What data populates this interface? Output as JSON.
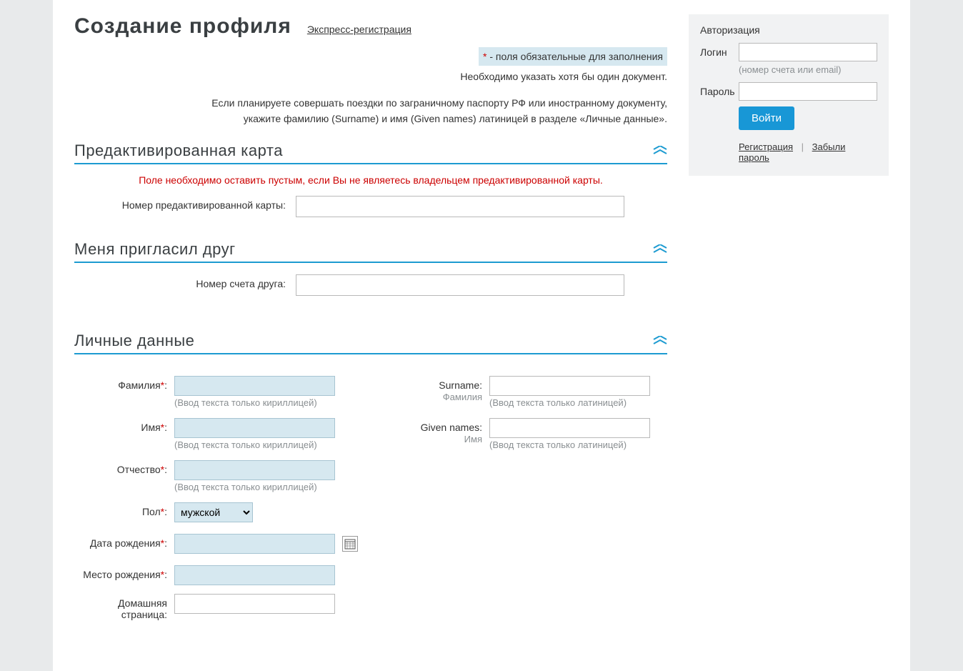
{
  "header": {
    "title": "Создание профиля",
    "express_link": "Экспресс-регистрация"
  },
  "info": {
    "req_hint_prefix": "*",
    "req_hint_text": " - поля обязательные для заполнения",
    "doc_hint": "Необходимо указать хотя бы один документ.",
    "passport_hint1": "Если планируете совершать поездки по заграничному паспорту РФ или иностранному документу,",
    "passport_hint2": "укажите фамилию (Surname) и имя (Given names) латиницей в разделе «Личные данные»."
  },
  "sections": {
    "precard": {
      "title": "Предактивированная карта",
      "hint_red": "Поле необходимо оставить пустым, если Вы не являетесь владельцем предактивированной карты.",
      "label": "Номер предактивированной карты:"
    },
    "friend": {
      "title": "Меня пригласил друг",
      "label": "Номер счета друга:"
    },
    "personal": {
      "title": "Личные данные",
      "surname_ru_label": "Фамилия",
      "name_ru_label": "Имя",
      "patronymic_label": "Отчество",
      "gender_label": "Пол",
      "birthdate_label": "Дата рождения",
      "birthplace_label": "Место рождения",
      "homepage_label": "Домашняя страница:",
      "surname_en_label": "Surname:",
      "surname_en_sub": "Фамилия",
      "given_en_label": "Given names:",
      "given_en_sub": "Имя",
      "hint_cyr": "(Ввод текста только кириллицей)",
      "hint_lat": "(Ввод текста только латиницей)",
      "gender_value": "мужской",
      "colon": ":"
    }
  },
  "auth": {
    "title": "Авторизация",
    "login_label": "Логин",
    "login_hint": "(номер счета или email)",
    "password_label": "Пароль",
    "login_button": "Войти",
    "register_link": "Регистрация",
    "sep": "|",
    "forgot_link": "Забыли пароль"
  }
}
